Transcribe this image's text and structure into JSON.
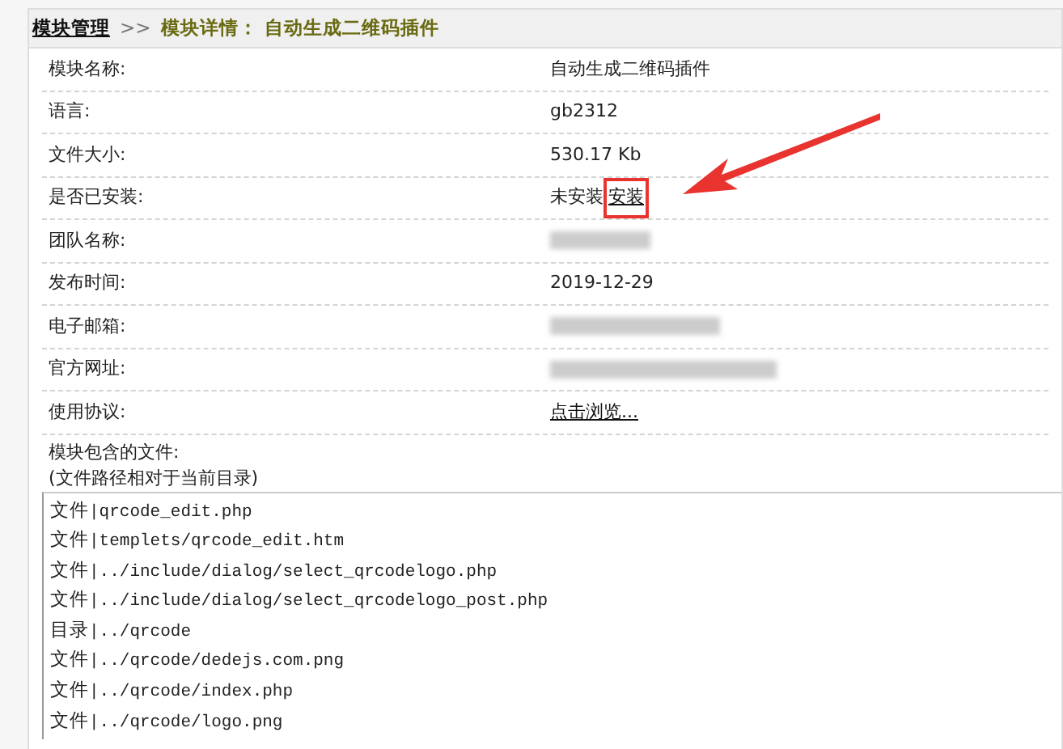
{
  "breadcrumb": {
    "root": "模块管理",
    "separator": ">>",
    "current": "模块详情： 自动生成二维码插件"
  },
  "fields": [
    {
      "label": "模块名称:",
      "kind": "text",
      "value": "自动生成二维码插件"
    },
    {
      "label": "语言:",
      "kind": "text",
      "value": "gb2312"
    },
    {
      "label": "文件大小:",
      "kind": "text",
      "value": "530.17 Kb"
    },
    {
      "label": "是否已安装:",
      "kind": "action",
      "value": "未安装",
      "action": {
        "label": "安装",
        "highlighted": true
      }
    },
    {
      "label": "团队名称:",
      "kind": "blurred"
    },
    {
      "label": "发布时间:",
      "kind": "text",
      "value": "2019-12-29"
    },
    {
      "label": "电子邮箱:",
      "kind": "blurred"
    },
    {
      "label": "官方网址:",
      "kind": "blurred"
    },
    {
      "label": "使用协议:",
      "kind": "link",
      "value": "点击浏览..."
    }
  ],
  "files_label": "模块包含的文件:",
  "files_note": "(文件路径相对于当前目录)",
  "files": [
    "文件|qrcode_edit.php",
    "文件|templets/qrcode_edit.htm",
    "文件|../include/dialog/select_qrcodelogo.php",
    "文件|../include/dialog/select_qrcodelogo_post.php",
    "目录|../qrcode",
    "文件|../qrcode/dedejs.com.png",
    "文件|../qrcode/index.php",
    "文件|../qrcode/logo.png"
  ]
}
